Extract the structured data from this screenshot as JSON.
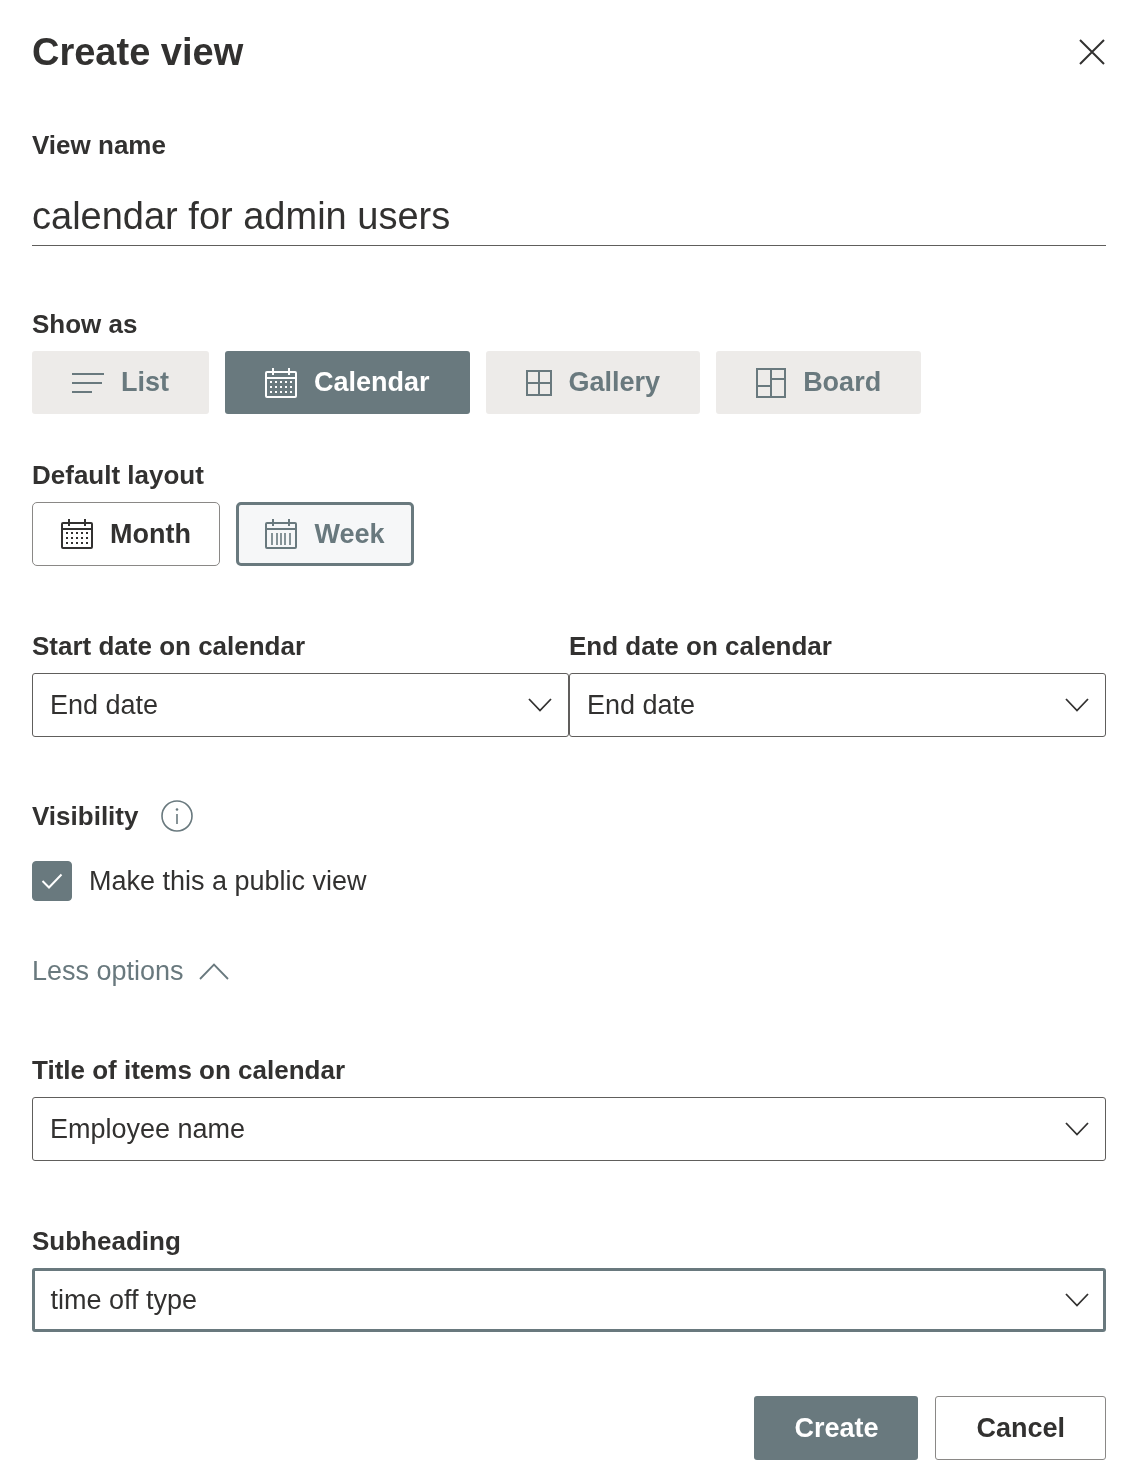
{
  "dialog": {
    "title": "Create view"
  },
  "view_name": {
    "label": "View name",
    "value": "calendar for admin users"
  },
  "show_as": {
    "label": "Show as",
    "options": [
      {
        "kind": "list",
        "label": "List",
        "selected": false
      },
      {
        "kind": "calendar",
        "label": "Calendar",
        "selected": true
      },
      {
        "kind": "gallery",
        "label": "Gallery",
        "selected": false
      },
      {
        "kind": "board",
        "label": "Board",
        "selected": false
      }
    ]
  },
  "default_layout": {
    "label": "Default layout",
    "options": [
      {
        "kind": "month",
        "label": "Month",
        "selected": false
      },
      {
        "kind": "week",
        "label": "Week",
        "selected": true
      }
    ]
  },
  "date_fields": [
    {
      "label": "Start date on calendar",
      "value": "End date",
      "focused": false
    },
    {
      "label": "End date on calendar",
      "value": "End date",
      "focused": false
    }
  ],
  "visibility": {
    "label": "Visibility",
    "checkbox": {
      "label": "Make this a public view",
      "checked": true
    }
  },
  "options_toggle": {
    "label": "Less options",
    "expanded": true
  },
  "title_field": {
    "label": "Title of items on calendar",
    "value": "Employee name",
    "focused": false
  },
  "subheading_field": {
    "label": "Subheading",
    "value": "time off type",
    "focused": true
  },
  "buttons": [
    {
      "kind": "primary",
      "label": "Create"
    },
    {
      "kind": "secondary",
      "label": "Cancel"
    }
  ]
}
